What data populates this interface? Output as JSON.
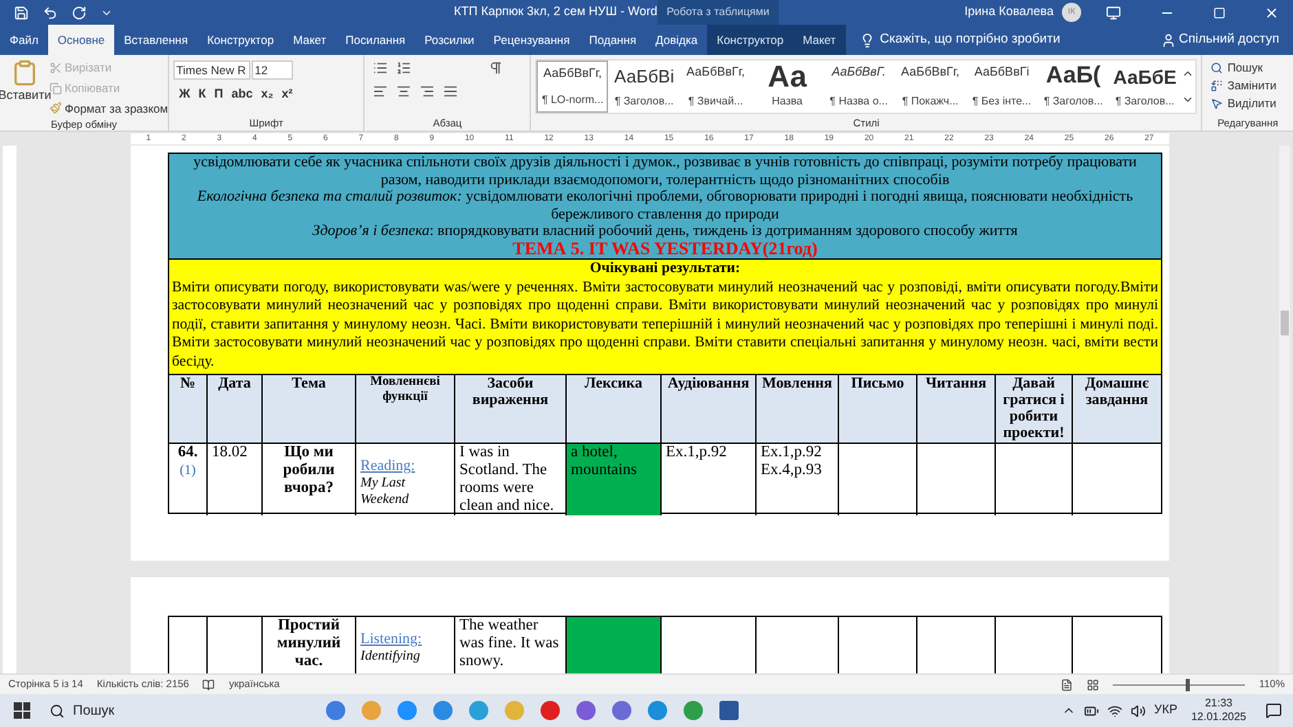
{
  "window": {
    "title": "КТП Карпюк 3кл, 2 сем НУШ  -  Word",
    "context_tab": "Робота з таблицями",
    "user": "Ірина Ковалева",
    "avatar": "ІК"
  },
  "menu_tabs": [
    {
      "label": "Файл",
      "selected": false,
      "context": false
    },
    {
      "label": "Основне",
      "selected": true,
      "context": false
    },
    {
      "label": "Вставлення",
      "selected": false,
      "context": false
    },
    {
      "label": "Конструктор",
      "selected": false,
      "context": false
    },
    {
      "label": "Макет",
      "selected": false,
      "context": false
    },
    {
      "label": "Посилання",
      "selected": false,
      "context": false
    },
    {
      "label": "Розсилки",
      "selected": false,
      "context": false
    },
    {
      "label": "Рецензування",
      "selected": false,
      "context": false
    },
    {
      "label": "Подання",
      "selected": false,
      "context": false
    },
    {
      "label": "Довідка",
      "selected": false,
      "context": false
    },
    {
      "label": "Конструктор",
      "selected": false,
      "context": true
    },
    {
      "label": "Макет",
      "selected": false,
      "context": true
    }
  ],
  "tell_me": "Скажіть, що потрібно зробити",
  "share": "Спільний доступ",
  "clipboard": {
    "paste": "Вставити",
    "cut": {
      "label": "Вирізати",
      "disabled": true
    },
    "copy": {
      "label": "Копіювати",
      "disabled": true
    },
    "format_painter": "Формат за зразком",
    "label": "Буфер обміну"
  },
  "font": {
    "name": "Times New R",
    "size": "12",
    "format_buttons": [
      "Ж",
      "К",
      "П",
      "abc",
      "x₂",
      "x²"
    ],
    "label": "Шрифт"
  },
  "paragraph": {
    "label": "Абзац"
  },
  "styles": {
    "label": "Стилі",
    "items": [
      {
        "sample": "АаБбВвГг,",
        "name": "¶ LO-norm...",
        "kind": "small",
        "selected": true
      },
      {
        "sample": "АаБбВі",
        "name": "¶ Заголов...",
        "kind": "medium",
        "selected": false
      },
      {
        "sample": "АаБбВвГг,",
        "name": "¶ Звичай...",
        "kind": "small",
        "selected": false
      },
      {
        "sample": "Аа",
        "name": "Назва",
        "kind": "title",
        "selected": false
      },
      {
        "sample": "АаБбВвГ.",
        "name": "¶ Назва о...",
        "kind": "italic",
        "selected": false
      },
      {
        "sample": "АаБбВвГг,",
        "name": "¶ Покажч...",
        "kind": "small",
        "selected": false
      },
      {
        "sample": "АаБбВвГі",
        "name": "¶ Без інте...",
        "kind": "small",
        "selected": false
      },
      {
        "sample": "АаБ(",
        "name": "¶ Заголов...",
        "kind": "large",
        "selected": false
      },
      {
        "sample": "АаБбЕ",
        "name": "¶ Заголов...",
        "kind": "bold",
        "selected": false
      }
    ]
  },
  "editing": {
    "label": "Редагування",
    "items": [
      "Пошук",
      "Замінити",
      "Виділити"
    ]
  },
  "ruler": [
    "1",
    "2",
    "3",
    "4",
    "5",
    "6",
    "7",
    "8",
    "9",
    "10",
    "11",
    "12",
    "13",
    "14",
    "15",
    "16",
    "17",
    "18",
    "19",
    "20",
    "21",
    "22",
    "23",
    "24",
    "25",
    "26",
    "27"
  ],
  "document": {
    "competences": [
      "усвідомлювати себе як учасника спільноти своїх друзів діяльності і думок., розвиває в учнів готовність до співпраці, розуміти потребу працювати разом, наводити приклади взаємодопомоги, толерантність щодо різноманітних способів",
      "*Екологічна безпека та сталий розвиток:* усвідомлювати екологічні проблеми, обговорювати природні і погодні явища, пояснювати необхідність бережливого ставлення до природи",
      "*Здоров’я і безпека*: впорядковувати власний робочий день, тиждень із дотриманням здорового способу життя"
    ],
    "theme": "ТЕМА 5. IT WAS YESTERDAY(21год)",
    "results_title": "Очікувані результати:",
    "results": "Вміти описувати погоду, використовувати was/were у реченнях. Вміти застосовувати минулий неозначений час у розповіді, вміти описувати погоду.Вміти застосовувати минулий неозначений час у розповідях про щоденні справи. Вміти використовувати минулий неозначений час у розповідях про минулі події, ставити запитання у минулому неозн. Часі. Вміти використовувати теперішній і минулий неозначений час у розповідях про теперішні і минулі поді. Вміти застосовувати минулий неозначений час у розповідях про щоденні справи. Вміти ставити спеціальні запитання у минулому неозн. часі, вміти вести бесіду.",
    "table": {
      "columns": [
        "№",
        "Дата",
        "Тема",
        "Мовленнєві функції",
        "Засоби вираження",
        "Лексика",
        "Аудіювання",
        "Мовлення",
        "Письмо",
        "Читання",
        "Давай гратися і робити проекти!",
        "Домашнє завдання"
      ],
      "rows": [
        [
          {
            "text": "64.",
            "note": "(1)",
            "bold": true
          },
          {
            "text": "18.02"
          },
          {
            "text": "Що ми робили вчора?",
            "bold": true
          },
          {
            "link": "Reading:",
            "text": "My Last Weekend"
          },
          {
            "text": "I was in Scotland. The rooms were clean and nice."
          },
          {
            "text": "a hotel, mountains",
            "highlight": true
          },
          {
            "text": "Ex.1,p.92"
          },
          {
            "text": "Ex.1,p.92 Ex.4,p.93"
          },
          {},
          {},
          {},
          {}
        ]
      ]
    },
    "table2_rows": [
      [
        {},
        {},
        {
          "text": "Простий минулий час.",
          "bold": true
        },
        {
          "link": "Listening:",
          "text": "Identifying"
        },
        {
          "text": "The weather was fine. It was snowy."
        },
        {
          "highlight": true
        },
        {},
        {},
        {},
        {},
        {},
        {}
      ]
    ]
  },
  "status_bar": {
    "page": "Сторінка 5 із 14",
    "words": "Кількість слів: 2156",
    "language": "українська",
    "zoom": "110%",
    "level": 0.55
  },
  "taskbar": {
    "search": "Пошук",
    "language": "УКР",
    "time": "21:33",
    "date": "12.01.2025"
  }
}
